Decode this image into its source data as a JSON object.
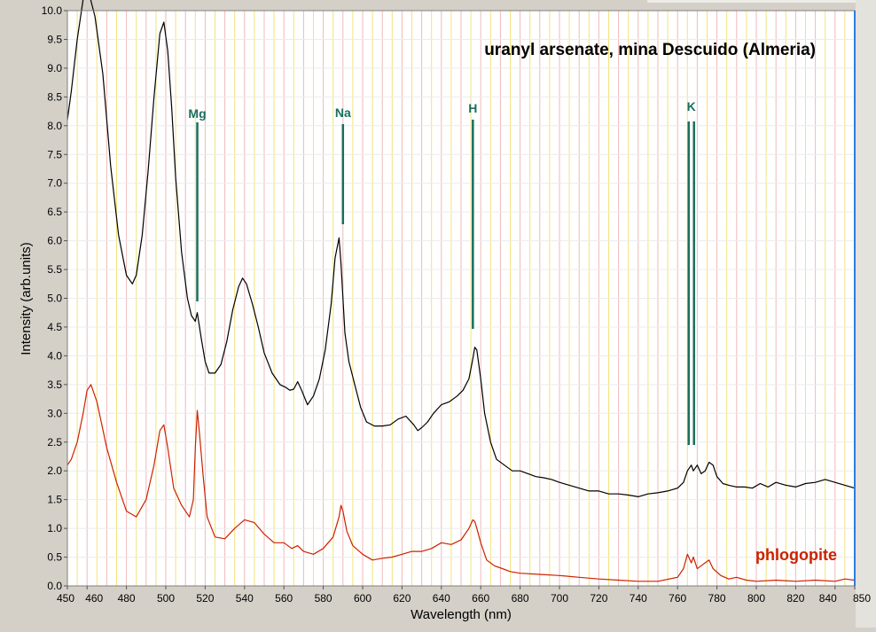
{
  "chart_data": {
    "type": "line",
    "title": "uranyl arsenate, mina Descuido (Almeria)",
    "xlabel": "Wavelength (nm)",
    "ylabel": "Intensity (arb.units)",
    "xlim": [
      450,
      850
    ],
    "ylim": [
      0,
      10
    ],
    "grid": true,
    "xticks": [
      "450",
      "460",
      "480",
      "500",
      "520",
      "540",
      "560",
      "580",
      "600",
      "620",
      "640",
      "660",
      "680",
      "700",
      "720",
      "740",
      "760",
      "780",
      "800",
      "820",
      "840",
      "850"
    ],
    "yticks": [
      "0.0",
      "0.5",
      "1.0",
      "1.5",
      "2.0",
      "2.5",
      "3.0",
      "3.5",
      "4.0",
      "4.5",
      "5.0",
      "5.5",
      "6.0",
      "6.5",
      "7.0",
      "7.5",
      "8.0",
      "8.5",
      "9.0",
      "9.5",
      "10.0"
    ],
    "series": [
      {
        "color": "#000000",
        "x": [
          450,
          452,
          455,
          458,
          461,
          464,
          468,
          472,
          476,
          480,
          483,
          485,
          488,
          491,
          494,
          497,
          499,
          501,
          503,
          505,
          508,
          511,
          513,
          515,
          516,
          518,
          520,
          522,
          525,
          528,
          531,
          534,
          537,
          539,
          541,
          544,
          547,
          550,
          554,
          558,
          561,
          563,
          565,
          567,
          569,
          572,
          575,
          578,
          581,
          584,
          586,
          588,
          589,
          590,
          591,
          593,
          596,
          599,
          602,
          606,
          610,
          614,
          618,
          622,
          626,
          628,
          630,
          633,
          636,
          640,
          644,
          648,
          651,
          654,
          656,
          657,
          658,
          660,
          662,
          665,
          668,
          672,
          676,
          680,
          684,
          688,
          692,
          696,
          700,
          705,
          710,
          715,
          720,
          725,
          730,
          735,
          740,
          745,
          750,
          755,
          760,
          763,
          765,
          767,
          768,
          770,
          772,
          774,
          776,
          778,
          780,
          783,
          786,
          790,
          794,
          798,
          802,
          806,
          810,
          815,
          820,
          825,
          830,
          835,
          840,
          845,
          850
        ],
        "y": [
          8.1,
          8.6,
          9.5,
          10.2,
          10.3,
          9.9,
          8.9,
          7.3,
          6.1,
          5.4,
          5.25,
          5.4,
          6.1,
          7.2,
          8.5,
          9.6,
          9.8,
          9.3,
          8.3,
          7.1,
          5.8,
          5.0,
          4.7,
          4.6,
          4.75,
          4.3,
          3.9,
          3.7,
          3.7,
          3.85,
          4.25,
          4.8,
          5.2,
          5.35,
          5.25,
          4.9,
          4.5,
          4.05,
          3.7,
          3.5,
          3.45,
          3.4,
          3.42,
          3.55,
          3.4,
          3.15,
          3.3,
          3.6,
          4.1,
          4.9,
          5.7,
          6.05,
          5.6,
          5.0,
          4.4,
          3.9,
          3.5,
          3.1,
          2.85,
          2.78,
          2.78,
          2.8,
          2.9,
          2.95,
          2.8,
          2.7,
          2.75,
          2.85,
          3.0,
          3.15,
          3.2,
          3.3,
          3.4,
          3.6,
          3.95,
          4.15,
          4.1,
          3.6,
          3.0,
          2.5,
          2.2,
          2.1,
          2.0,
          2.0,
          1.95,
          1.9,
          1.88,
          1.85,
          1.8,
          1.75,
          1.7,
          1.65,
          1.65,
          1.6,
          1.6,
          1.58,
          1.55,
          1.6,
          1.62,
          1.65,
          1.7,
          1.8,
          2.0,
          2.1,
          2.0,
          2.1,
          1.95,
          2.0,
          2.15,
          2.1,
          1.9,
          1.78,
          1.75,
          1.72,
          1.72,
          1.7,
          1.78,
          1.72,
          1.8,
          1.75,
          1.72,
          1.78,
          1.8,
          1.85,
          1.8,
          1.75,
          1.7
        ]
      },
      {
        "name": "phlogopite",
        "color": "#cc2200",
        "x": [
          450,
          452,
          455,
          458,
          460,
          462,
          465,
          470,
          475,
          480,
          485,
          490,
          494,
          497,
          499,
          501,
          504,
          508,
          512,
          514,
          515,
          516,
          517,
          519,
          521,
          525,
          530,
          535,
          540,
          545,
          550,
          555,
          560,
          564,
          567,
          570,
          575,
          580,
          585,
          588,
          589,
          590,
          592,
          595,
          600,
          605,
          610,
          615,
          620,
          625,
          630,
          635,
          640,
          645,
          650,
          654,
          656,
          657,
          658,
          660,
          663,
          667,
          671,
          675,
          680,
          690,
          700,
          710,
          720,
          730,
          740,
          750,
          760,
          763,
          765,
          767,
          768,
          770,
          772,
          774,
          776,
          778,
          782,
          786,
          790,
          795,
          800,
          810,
          820,
          830,
          840,
          845,
          850
        ],
        "y": [
          2.1,
          2.2,
          2.5,
          3.0,
          3.4,
          3.5,
          3.2,
          2.4,
          1.8,
          1.3,
          1.2,
          1.5,
          2.1,
          2.7,
          2.8,
          2.4,
          1.7,
          1.4,
          1.2,
          1.5,
          2.4,
          3.05,
          2.7,
          1.9,
          1.2,
          0.85,
          0.82,
          1.0,
          1.15,
          1.1,
          0.9,
          0.75,
          0.75,
          0.65,
          0.7,
          0.6,
          0.55,
          0.65,
          0.85,
          1.2,
          1.4,
          1.3,
          0.95,
          0.7,
          0.55,
          0.45,
          0.48,
          0.5,
          0.55,
          0.6,
          0.6,
          0.65,
          0.75,
          0.72,
          0.8,
          1.0,
          1.15,
          1.12,
          1.0,
          0.75,
          0.45,
          0.35,
          0.3,
          0.25,
          0.22,
          0.2,
          0.18,
          0.15,
          0.12,
          0.1,
          0.08,
          0.08,
          0.15,
          0.3,
          0.55,
          0.4,
          0.5,
          0.3,
          0.35,
          0.4,
          0.45,
          0.3,
          0.18,
          0.12,
          0.15,
          0.1,
          0.08,
          0.1,
          0.08,
          0.1,
          0.08,
          0.12,
          0.1
        ]
      }
    ],
    "annotations": [
      {
        "label": "Mg",
        "x": 516,
        "color": "#1a6e5e"
      },
      {
        "label": "Na",
        "x": 590,
        "color": "#1a6e5e"
      },
      {
        "label": "H",
        "x": 656,
        "color": "#1a6e5e"
      },
      {
        "label": "K",
        "x": 767,
        "color": "#1a6e5e"
      }
    ]
  }
}
